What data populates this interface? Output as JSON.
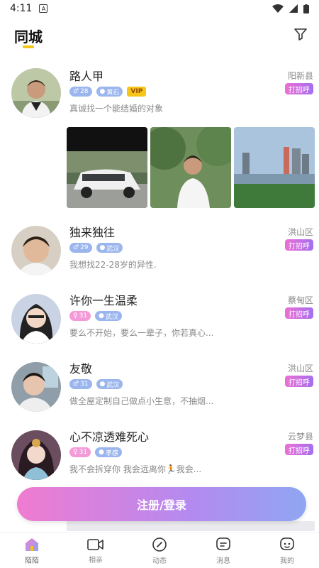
{
  "status": {
    "time": "4:11"
  },
  "header": {
    "title": "同城"
  },
  "posts": [
    {
      "name": "路人甲",
      "age": "28",
      "city": "黄石",
      "vip": "VIP",
      "location": "阳新县",
      "greet": "打招呼",
      "bio": "真诚找一个能结婚的对象",
      "gender": "male"
    },
    {
      "name": "独来独往",
      "age": "29",
      "city": "武汉",
      "location": "洪山区",
      "greet": "打招呼",
      "bio": "我想找22-28岁的异性.",
      "gender": "male"
    },
    {
      "name": "许你一生温柔",
      "age": "31",
      "city": "武汉",
      "location": "蔡甸区",
      "greet": "打招呼",
      "bio": "要么不开始，要么一辈子，你若真心...",
      "gender": "female"
    },
    {
      "name": "友敬",
      "age": "31",
      "city": "武汉",
      "location": "洪山区",
      "greet": "打招呼",
      "bio": "做全屋定制自己做点小生意，不抽烟...",
      "gender": "male"
    },
    {
      "name": "心不凉透难死心",
      "age": "31",
      "city": "孝感",
      "location": "云梦县",
      "greet": "打招呼",
      "bio": "我不会拆穿你 我会远离你🏃我会...",
      "gender": "female"
    }
  ],
  "cta": {
    "login_label": "注册/登录"
  },
  "tabs": [
    {
      "label": "陌陌",
      "icon": "home-icon"
    },
    {
      "label": "相亲",
      "icon": "video-icon"
    },
    {
      "label": "动态",
      "icon": "compass-icon"
    },
    {
      "label": "消息",
      "icon": "message-icon"
    },
    {
      "label": "我的",
      "icon": "profile-icon"
    }
  ],
  "colors": {
    "accent": "#f5c518",
    "gradient_start": "#f07bd0",
    "gradient_end": "#8fa6f2",
    "male_tag": "#9bb6ee",
    "female_tag": "#f59ad8"
  }
}
